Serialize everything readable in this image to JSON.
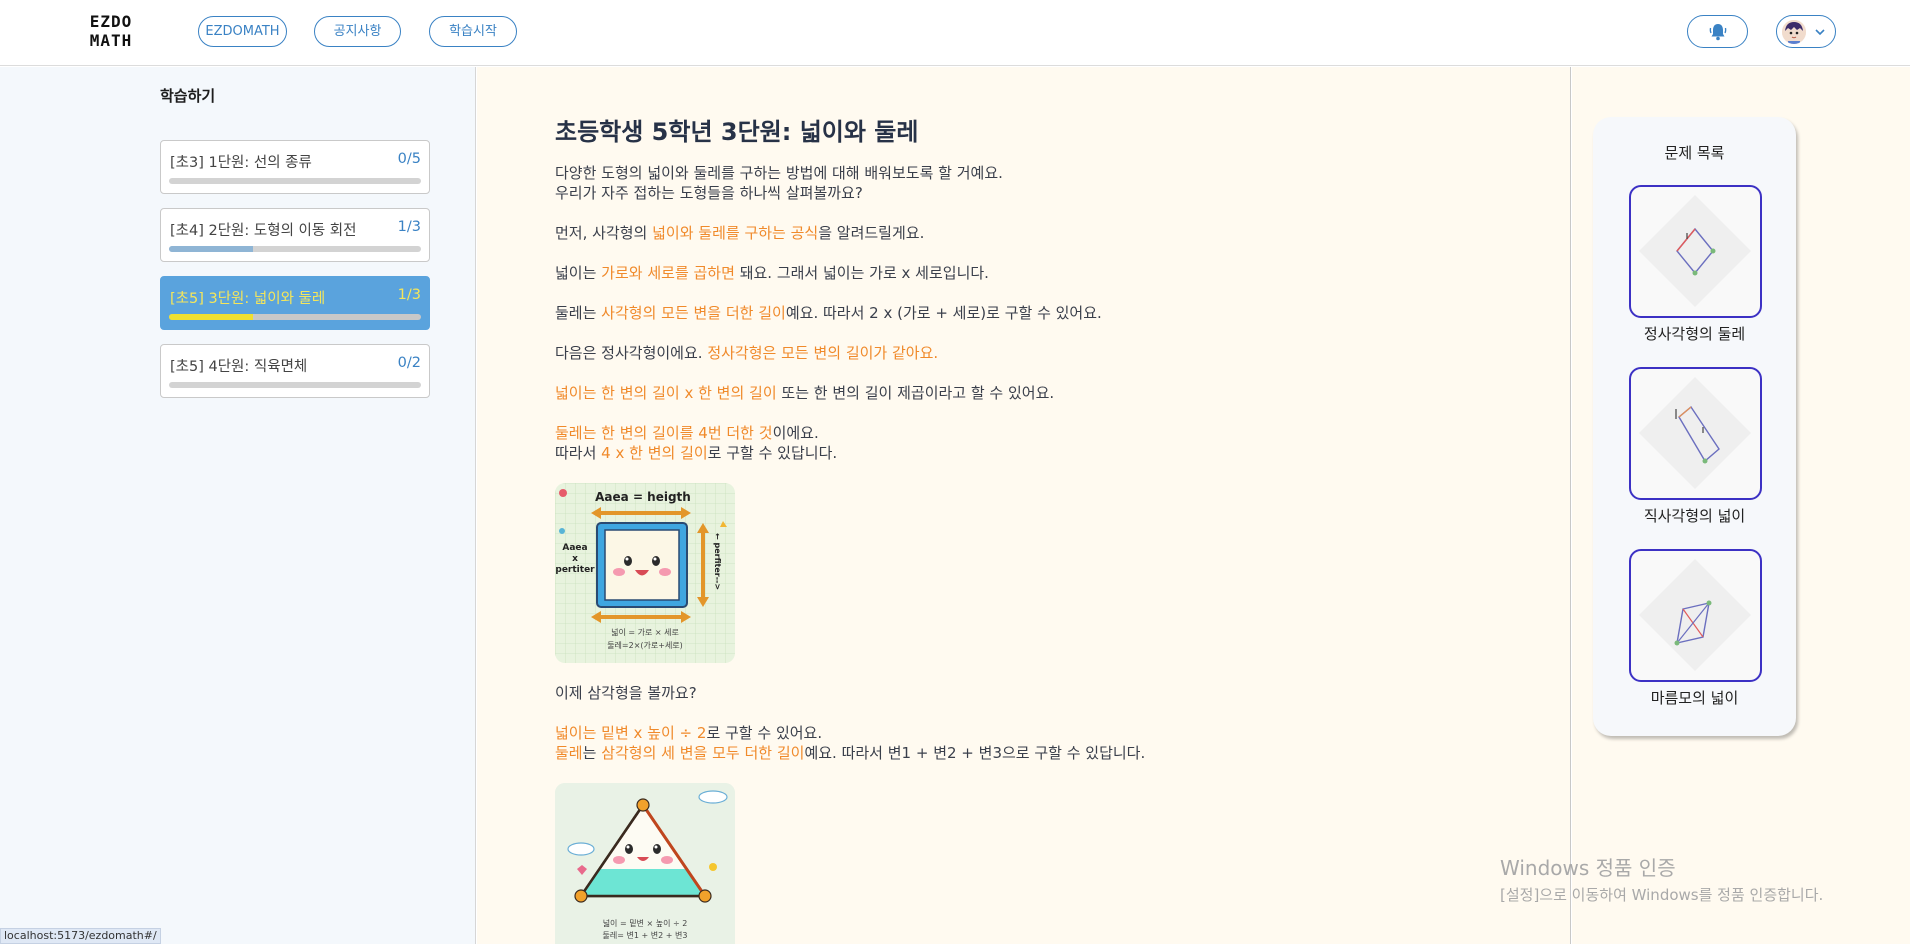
{
  "header": {
    "logo_line1": "EZDO",
    "logo_line2": "MATH",
    "nav": [
      "EZDOMATH",
      "공지사항",
      "학습시작"
    ],
    "bell_icon": "bell-icon",
    "profile_icon": "avatar",
    "dropdown_icon": "chevron-down-icon"
  },
  "sidebar": {
    "title": "학습하기",
    "units": [
      {
        "label": "[초3] 1단원: 선의 종류",
        "count": "0/5",
        "progress": 0.0,
        "active": false
      },
      {
        "label": "[초4] 2단원: 도형의 이동 회전",
        "count": "1/3",
        "progress": 0.333,
        "active": false
      },
      {
        "label": "[초5] 3단원: 넓이와 둘레",
        "count": "1/3",
        "progress": 0.333,
        "active": true
      },
      {
        "label": "[초5] 4단원: 직육면체",
        "count": "0/2",
        "progress": 0.0,
        "active": false
      }
    ]
  },
  "main": {
    "title": "초등학생 5학년 3단원: 넓이와 둘레",
    "intro1": "다양한 도형의 넓이와 둘레를 구하는 방법에 대해 배워보도록 할 거예요.",
    "intro2": "우리가 자주 접하는 도형들을 하나씩 살펴볼까요?",
    "p1": {
      "a": "먼저, 사각형의 ",
      "hl": "넓이와 둘레를 구하는 공식",
      "b": "을 알려드릴게요."
    },
    "p2": {
      "a": "넓이는 ",
      "hl": "가로와 세로를 곱하면",
      "b": " 돼요. 그래서 넓이는 가로 x 세로입니다."
    },
    "p3": {
      "a": "둘레는 ",
      "hl": "사각형의 모든 변을 더한 길이",
      "b": "예요. 따라서 2 x (가로 + 세로)로 구할 수 있어요."
    },
    "p4": {
      "a": "다음은 정사각형이에요. ",
      "hl": "정사각형은 모든 변의 길이가 같아요."
    },
    "p5": {
      "hl": "넓이는 한 변의 길이 x 한 변의 길이",
      "b": " 또는 한 변의 길이 제곱이라고 할 수 있어요."
    },
    "p6a": {
      "hl": "둘레는 한 변의 길이를 4번 더한 것",
      "b": "이에요."
    },
    "p6b": {
      "a": "따라서 ",
      "hl": "4 x 한 변의 길이",
      "b": "로 구할 수 있답니다."
    },
    "square_img": {
      "top_text": "Aaea = heigth",
      "left_text1": "Aaea",
      "left_text2": "x",
      "left_text3": "pertiter",
      "right_text": "← perfiter-->",
      "caption1": "넓이 = 가로 × 세로",
      "caption2": "둘레=2×(가로+세로)"
    },
    "p7": "이제 삼각형을 볼까요?",
    "p8": {
      "hl": "넓이는 밑변 x 높이 ÷ 2",
      "b": "로 구할 수 있어요."
    },
    "p9": {
      "hl1": "둘레",
      "a": "는 ",
      "hl2": "삼각형의 세 변을 모두 더한 길이",
      "b": "예요. 따라서 변1 + 변2 + 변3으로 구할 수 있답니다."
    },
    "triangle_img": {
      "caption1": "넓이 = 밑변 × 높이 ÷ 2",
      "caption2": "둘레= 변1 + 변2 + 변3"
    }
  },
  "problems": {
    "title": "문제 목록",
    "items": [
      {
        "label": "정사각형의 둘레"
      },
      {
        "label": "직사각형의 넓이"
      },
      {
        "label": "마름모의 넓이"
      }
    ]
  },
  "overlay": {
    "win_title": "Windows 정품 인증",
    "win_sub": "[설정]으로 이동하여 Windows를 정품 인증합니다.",
    "status_url": "localhost:5173/ezdomath#/"
  },
  "colors": {
    "accent": "#3a82c4",
    "highlight": "#f08a2b",
    "active_card": "#5aa3dd",
    "active_text": "#f5e65a",
    "problem_border": "#3c31c4"
  }
}
